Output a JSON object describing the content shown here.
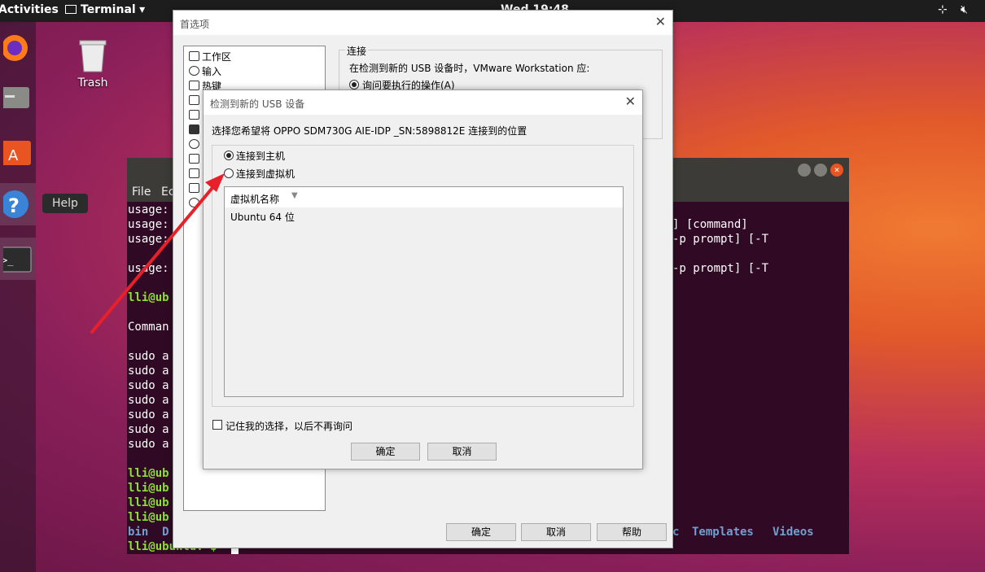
{
  "topbar": {
    "activities": "Activities",
    "app": "Terminal",
    "clock": "Wed 19:48"
  },
  "desktop": {
    "trash": "Trash",
    "tooltip": "Help"
  },
  "terminal": {
    "menu": [
      "File",
      "Ec"
    ],
    "lines_left": [
      "usage:",
      "usage:",
      "usage:",
      "",
      "usage:",
      "",
      "lli@ub",
      "",
      "Comman",
      "",
      "sudo a",
      "sudo a",
      "sudo a",
      "sudo a",
      "sudo a",
      "sudo a",
      "sudo a",
      "",
      "lli@ub",
      "lli@ub",
      "lli@ub",
      "lli@ub"
    ],
    "line_right_1": "] [command]",
    "line_right_2": "-p prompt] [-T",
    "line_right_3": "-p prompt] [-T",
    "bin_line": "bin  D",
    "dirs_tail": [
      "c",
      "Templates",
      "Videos"
    ],
    "prompt": "lli@ubuntu:~$"
  },
  "prefs": {
    "title": "首选项",
    "tree": [
      "工作区",
      "输入",
      "热键"
    ],
    "section": "连接",
    "desc": "在检测到新的 USB 设备时，VMware Workstation 应:",
    "option": "询问要执行的操作(A)",
    "ok": "确定",
    "cancel": "取消",
    "help": "帮助"
  },
  "usb": {
    "title": "检测到新的 USB 设备",
    "prompt": "选择您希望将 OPPO SDM730G AIE-IDP _SN:5898812E 连接到的位置",
    "opt_host": "连接到主机",
    "opt_vm": "连接到虚拟机",
    "col_header": "虚拟机名称",
    "vm_rows": [
      "Ubuntu 64 位"
    ],
    "remember": "记住我的选择，以后不再询问",
    "ok": "确定",
    "cancel": "取消",
    "selected": "opt_host"
  },
  "colors": {
    "annotation_arrow": "#e8202a"
  }
}
